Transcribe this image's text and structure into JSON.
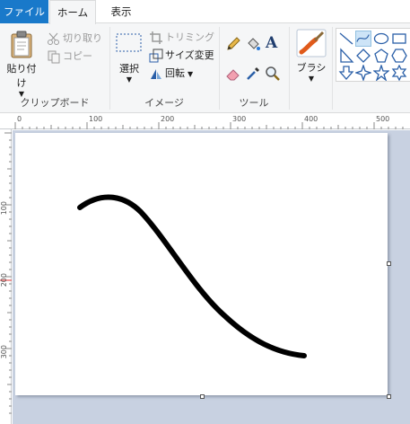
{
  "tabs": {
    "file": "ファイル",
    "home": "ホーム",
    "view": "表示"
  },
  "clipboard": {
    "paste": "貼り付け",
    "cut": "切り取り",
    "copy": "コピー",
    "label": "クリップボード"
  },
  "image": {
    "select": "選択",
    "crop": "トリミング",
    "resize": "サイズ変更",
    "rotate": "回転",
    "label": "イメージ"
  },
  "tools": {
    "label": "ツール"
  },
  "brushes": {
    "label": "ブラシ"
  },
  "ruler": {
    "top": [
      "0",
      "100",
      "200",
      "300",
      "400",
      "500"
    ],
    "left": [
      "100",
      "200",
      "300"
    ]
  },
  "colors": {
    "accent": "#1979ca",
    "workspace": "#c8d1e1",
    "stroke": "#000000"
  }
}
